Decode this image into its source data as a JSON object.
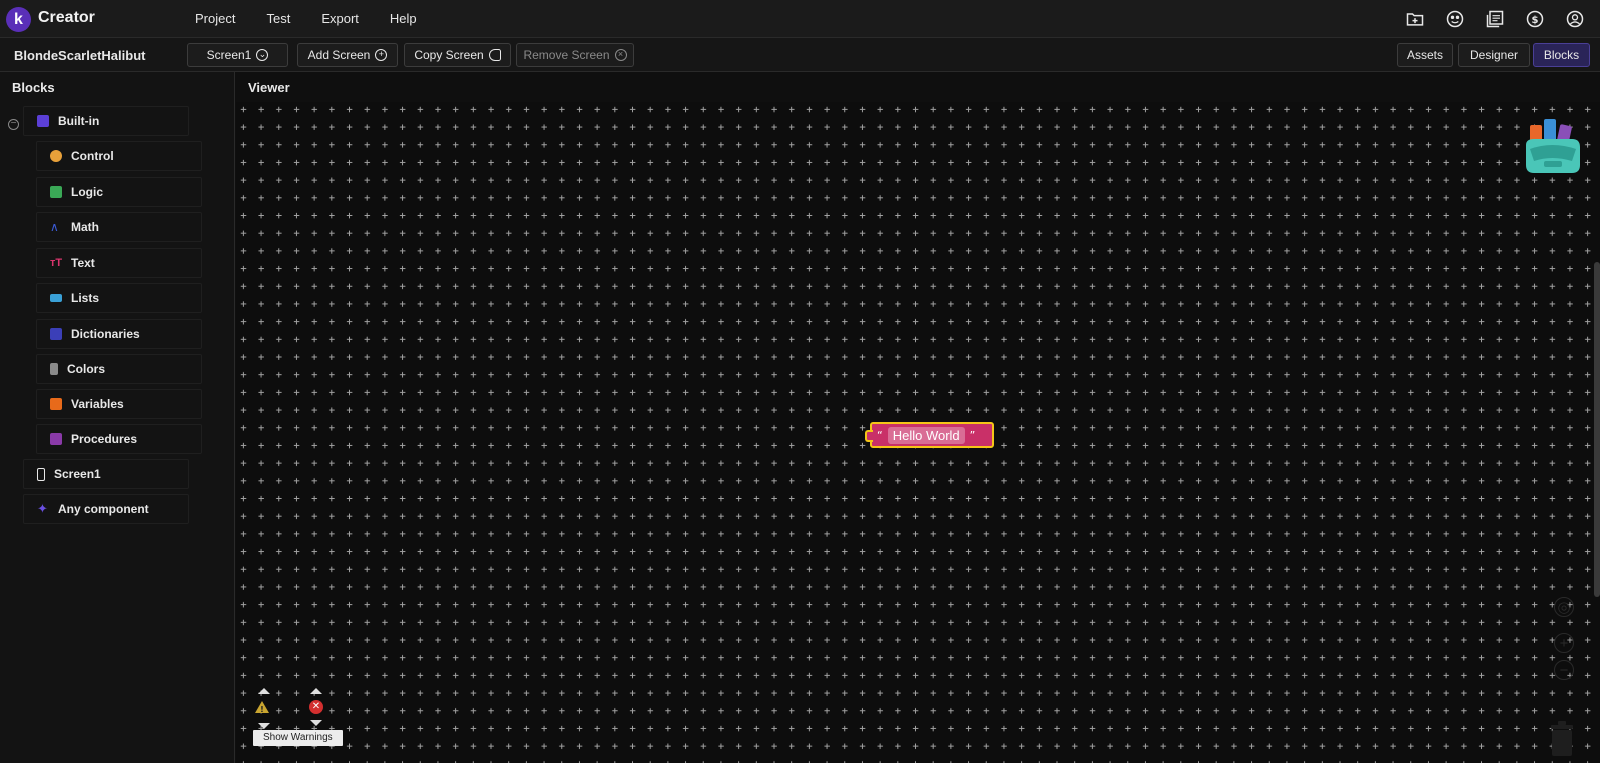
{
  "app": {
    "logo_letter": "k",
    "name": "Creator",
    "menu": [
      "Project",
      "Test",
      "Export",
      "Help"
    ],
    "top_icons": [
      "folder-add-icon",
      "face-icon",
      "library-icon",
      "dollar-icon",
      "account-icon"
    ]
  },
  "subbar": {
    "project_name": "BlondeScarletHalibut",
    "screen_select": "Screen1",
    "add_screen": "Add Screen",
    "copy_screen": "Copy Screen",
    "remove_screen": "Remove Screen",
    "assets": "Assets",
    "designer": "Designer",
    "blocks": "Blocks",
    "active_view": "Blocks"
  },
  "sidebar": {
    "title": "Blocks",
    "builtin": {
      "label": "Built-in",
      "color": "#5b3fd6"
    },
    "categories": [
      {
        "label": "Control",
        "color": "#e8a13a"
      },
      {
        "label": "Logic",
        "color": "#3aa856"
      },
      {
        "label": "Math",
        "color": "#3b5bd6"
      },
      {
        "label": "Text",
        "color": "#d8346c"
      },
      {
        "label": "Lists",
        "color": "#3aa0d6"
      },
      {
        "label": "Dictionaries",
        "color": "#3b3fb8"
      },
      {
        "label": "Colors",
        "color": "#8a8a8a"
      },
      {
        "label": "Variables",
        "color": "#e86a1a"
      },
      {
        "label": "Procedures",
        "color": "#8a3aa8"
      }
    ],
    "screen": "Screen1",
    "any_component": "Any component"
  },
  "viewer": {
    "title": "Viewer",
    "block_text": "Hello World",
    "block_color": "#c93068",
    "highlight_color": "#f5c518",
    "show_warnings": "Show Warnings"
  }
}
